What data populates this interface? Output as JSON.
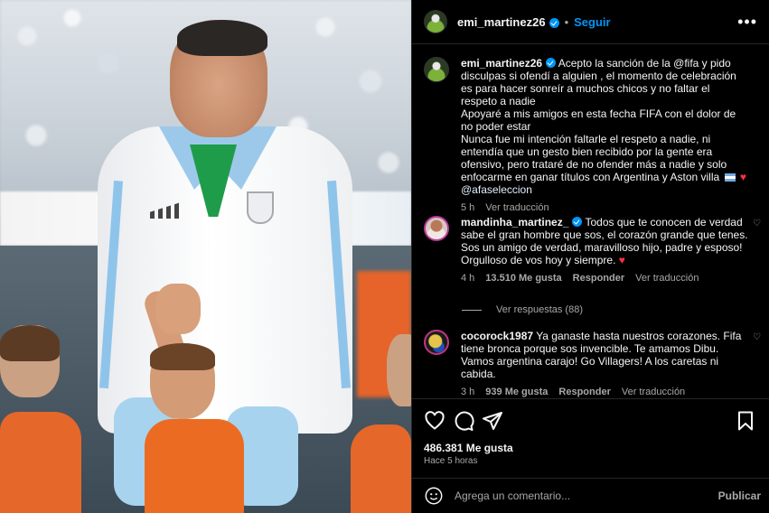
{
  "post": {
    "username": "emi_martinez26",
    "follow_label": "Seguir",
    "more_label": "•••"
  },
  "caption": {
    "username": "emi_martinez26",
    "text_1": "Acepto la sanción de la @fifa y pido disculpas si ofendí a alguien , el momento de celebración es para hacer sonreír a muchos chicos y no faltar el respeto a nadie",
    "text_2": "Apoyaré a mis amigos en esta fecha FIFA con el dolor de no poder estar",
    "text_3": "Nunca fue mi intención faltarle el respeto a nadie, ni entendía que un gesto bien recibido por la gente era ofensivo, pero trataré de no ofender más a nadie y solo enfocarme en ganar títulos con Argentina y Aston villa",
    "mention": "@afaseleccion",
    "time": "5 h",
    "translate": "Ver traducción"
  },
  "comments": [
    {
      "username": "mandinha_martinez_",
      "text_1": "Todos que te conocen de verdad sabe el gran hombre que sos, el corazón grande que tenes. Sos un amigo de verdad, maravilloso hijo, padre y esposo! Orgulloso de vos hoy y siempre.",
      "time": "4 h",
      "likes": "13.510 Me gusta",
      "reply": "Responder",
      "translate": "Ver traducción",
      "replies": "Ver respuestas (88)"
    },
    {
      "username": "cocorock1987",
      "text_1": "Ya ganaste hasta nuestros corazones. Fifa tiene bronca porque sos invencible. Te amamos Dibu. Vamos argentina carajo! Go Villagers! A los caretas ni cabida.",
      "time": "3 h",
      "likes": "939 Me gusta",
      "reply": "Responder",
      "translate": "Ver traducción"
    }
  ],
  "footer": {
    "likes": "486.381 Me gusta",
    "time": "Hace 5 horas",
    "comment_placeholder": "Agrega un comentario...",
    "publish_label": "Publicar"
  },
  "icons": {
    "like": "heart-icon",
    "comment": "comment-bubble-icon",
    "share": "paper-plane-icon",
    "save": "bookmark-icon",
    "emoji": "emoji-icon",
    "verified": "verified-badge-icon",
    "options": "more-options-icon"
  },
  "colors": {
    "background": "#000000",
    "link_blue": "#0095f6",
    "secondary_text": "#a8a8a8",
    "heart_red": "#ff3040"
  }
}
